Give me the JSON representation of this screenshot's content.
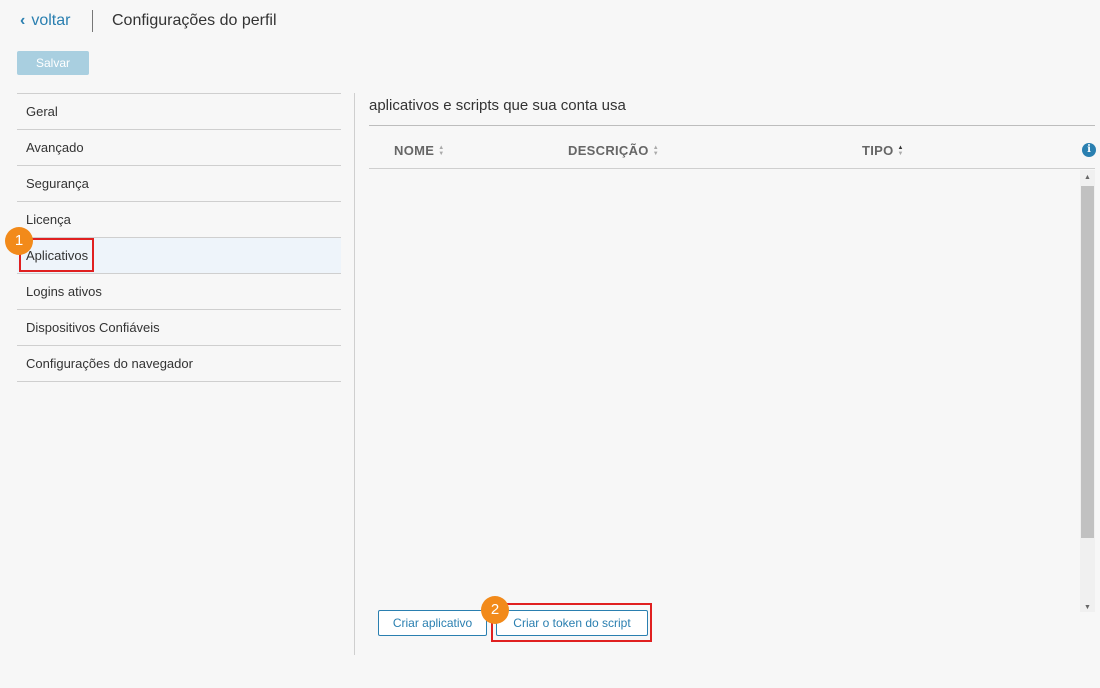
{
  "header": {
    "back_label": "voltar",
    "title": "Configurações do perfil"
  },
  "toolbar": {
    "save_label": "Salvar"
  },
  "sidebar": {
    "items": [
      {
        "label": "Geral"
      },
      {
        "label": "Avançado"
      },
      {
        "label": "Segurança"
      },
      {
        "label": "Licença"
      },
      {
        "label": "Aplicativos",
        "active": true
      },
      {
        "label": "Logins ativos"
      },
      {
        "label": "Dispositivos Confiáveis"
      },
      {
        "label": "Configurações do navegador"
      }
    ]
  },
  "main": {
    "section_title": "aplicativos e scripts que sua conta usa",
    "columns": [
      {
        "label": "NOME",
        "sort": "none"
      },
      {
        "label": "DESCRIÇÃO",
        "sort": "none"
      },
      {
        "label": "TIPO",
        "sort": "asc"
      }
    ],
    "info_icon": "info-icon",
    "rows": [],
    "buttons": {
      "create_app": "Criar aplicativo",
      "create_token": "Criar o token do script"
    }
  },
  "annotations": {
    "badge_1": "1",
    "badge_2": "2",
    "highlight_color": "#e02020",
    "badge_color": "#f28a1a"
  },
  "colors": {
    "accent": "#2a7fb0",
    "save_disabled": "#a9cfe0"
  }
}
